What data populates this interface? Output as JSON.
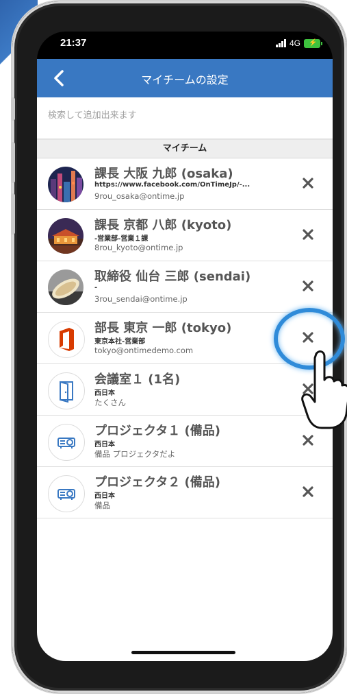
{
  "status": {
    "time": "21:37",
    "network": "4G"
  },
  "header": {
    "title": "マイチームの設定",
    "back_icon": "chevron-left-icon"
  },
  "search": {
    "placeholder": "検索して追加出来ます"
  },
  "section": {
    "title": "マイチーム"
  },
  "colors": {
    "header": "#3978c2",
    "ring": "#2f8bd9"
  },
  "members": [
    {
      "name": "課長 大阪 九郎 (osaka)",
      "dept": "https://www.facebook.com/OnTimeJp/-...",
      "sub": "9rou_osaka@ontime.jp",
      "avatar": "city-night-photo"
    },
    {
      "name": "課長 京都 八郎 (kyoto)",
      "dept": "-営業部-営業１課",
      "sub": "8rou_kyoto@ontime.jp",
      "avatar": "temple-night-photo"
    },
    {
      "name": "取締役 仙台 三郎 (sendai)",
      "dept": "-",
      "sub": "3rou_sendai@ontime.jp",
      "avatar": "food-photo"
    },
    {
      "name": "部長 東京 一郎 (tokyo)",
      "dept": "東京本社-営業部",
      "sub": "tokyo@ontimedemo.com",
      "avatar": "office-logo-icon"
    },
    {
      "name": "会議室１ (1名)",
      "dept": "西日本",
      "sub": "たくさん",
      "avatar": "door-icon"
    },
    {
      "name": "プロジェクタ１ (備品)",
      "dept": "西日本",
      "sub": "備品 プロジェクタだよ",
      "avatar": "projector-icon"
    },
    {
      "name": "プロジェクタ２ (備品)",
      "dept": "西日本",
      "sub": "備品",
      "avatar": "projector-icon"
    }
  ]
}
